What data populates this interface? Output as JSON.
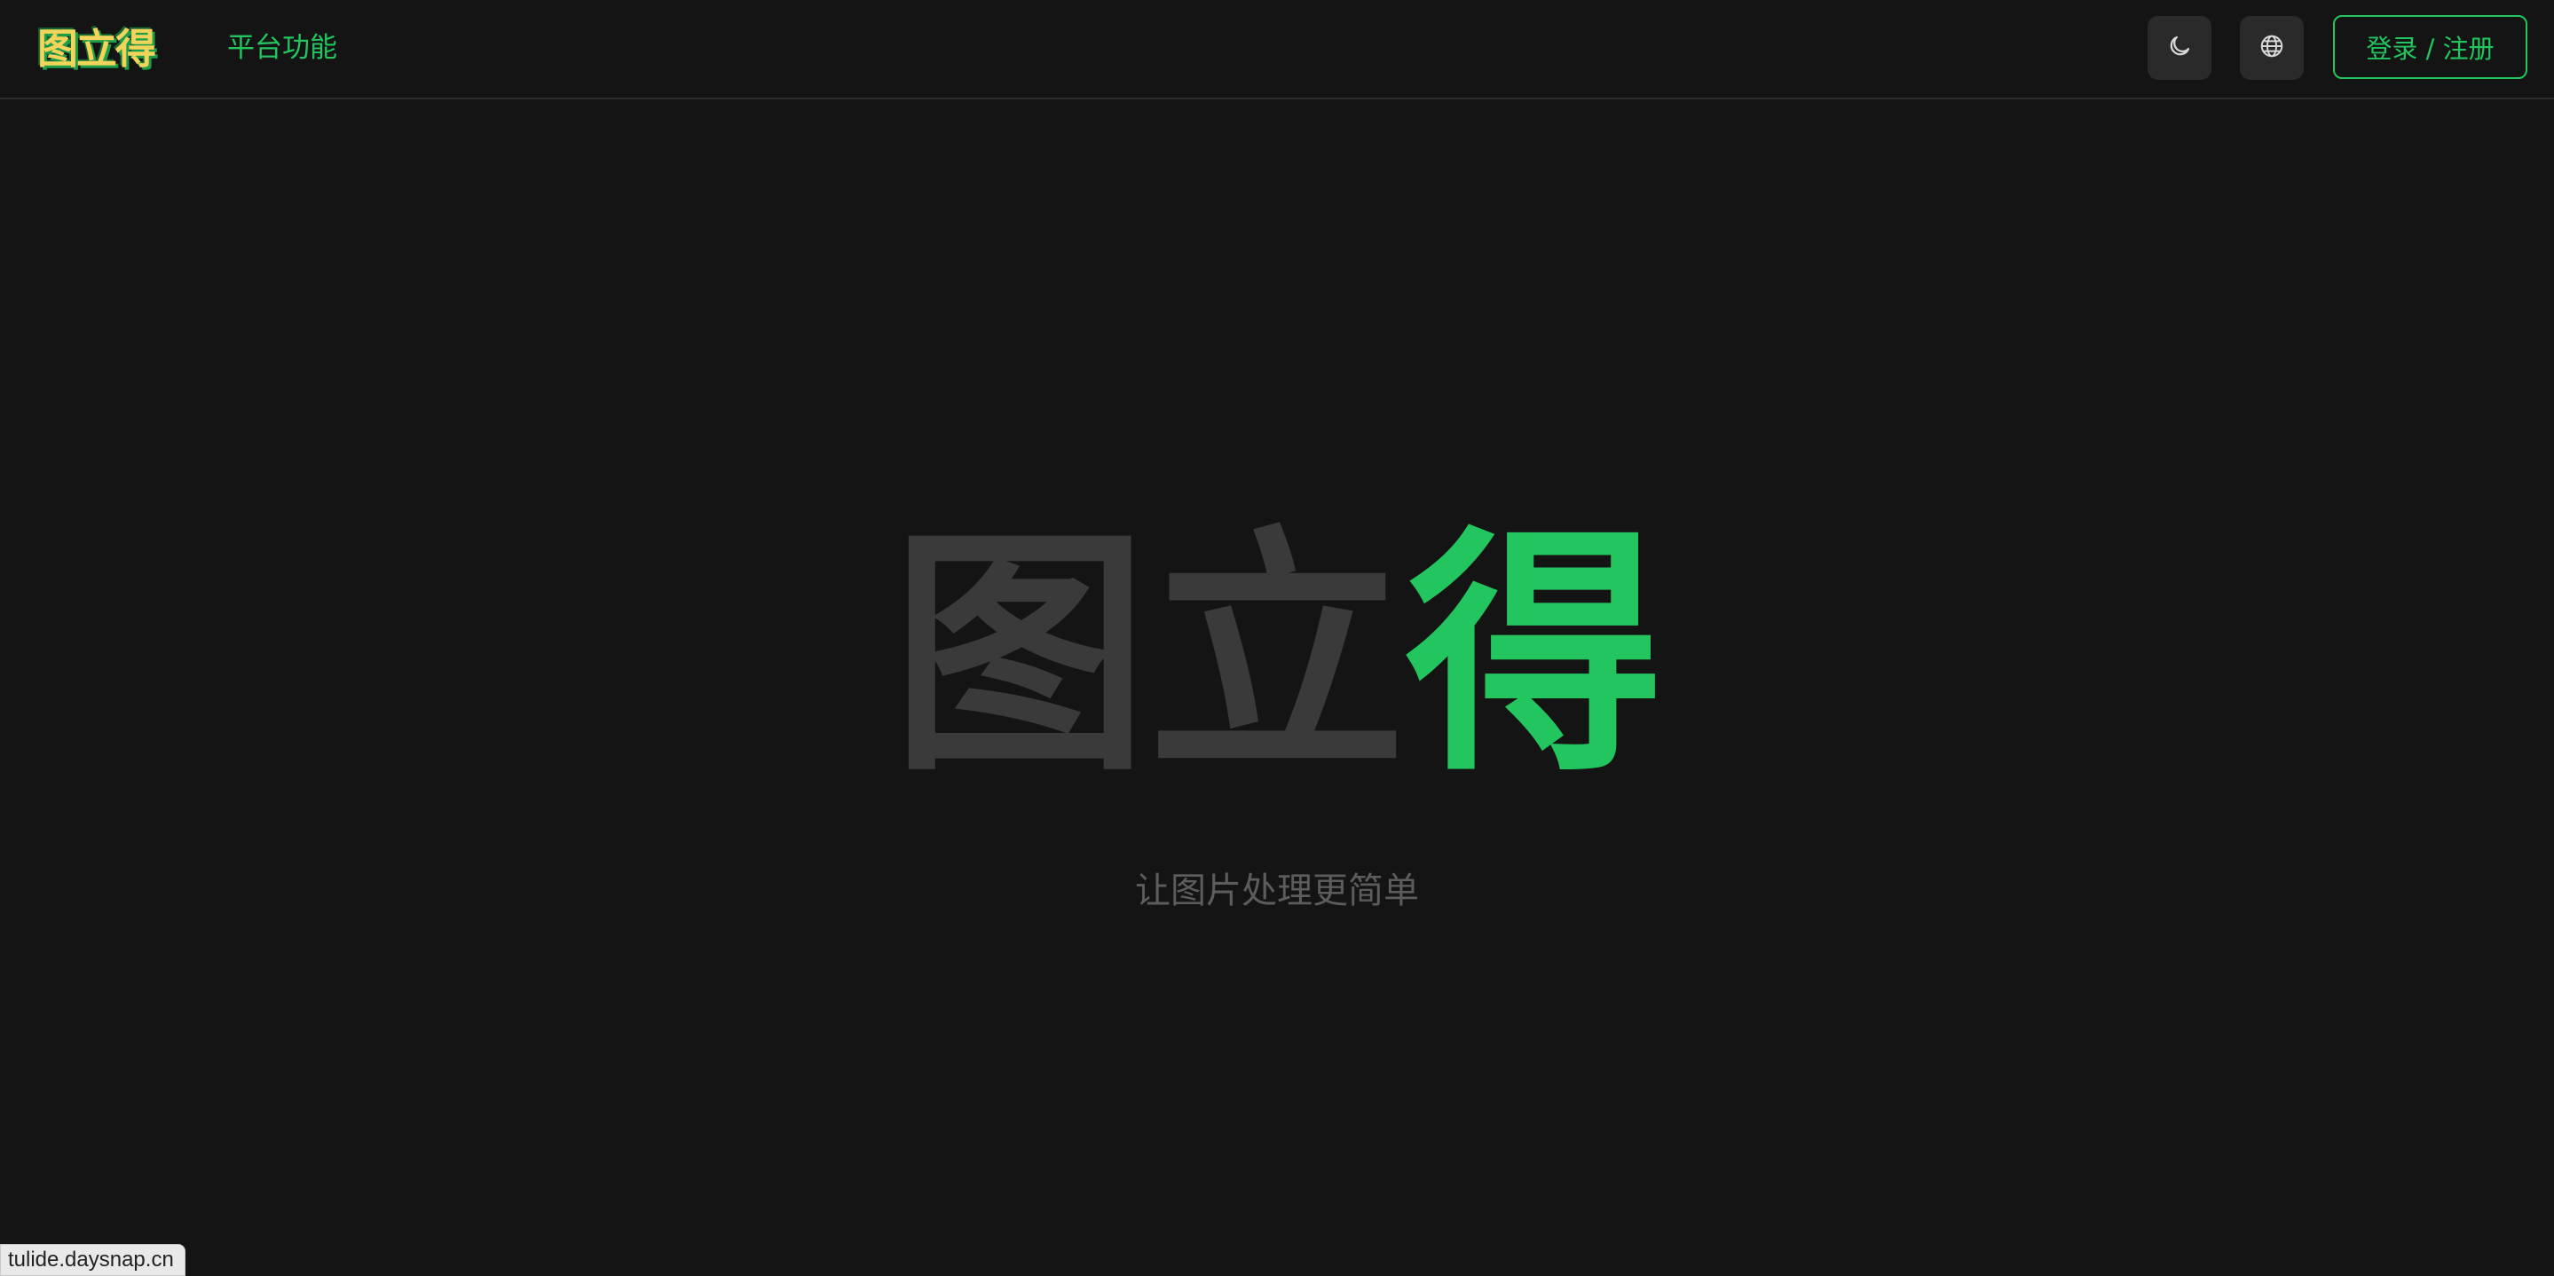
{
  "header": {
    "logo_text": "图立得",
    "nav": {
      "features_label": "平台功能"
    },
    "theme_toggle_icon": "moon-icon",
    "language_icon": "globe-icon",
    "login_label": "登录 / 注册"
  },
  "hero": {
    "title_part1": "图立",
    "title_part2": "得",
    "subtitle": "让图片处理更简单"
  },
  "status_bar": {
    "url": "tulide.daysnap.cn"
  },
  "colors": {
    "background": "#141414",
    "accent": "#22c55e",
    "muted_text": "#3a3a3a"
  }
}
